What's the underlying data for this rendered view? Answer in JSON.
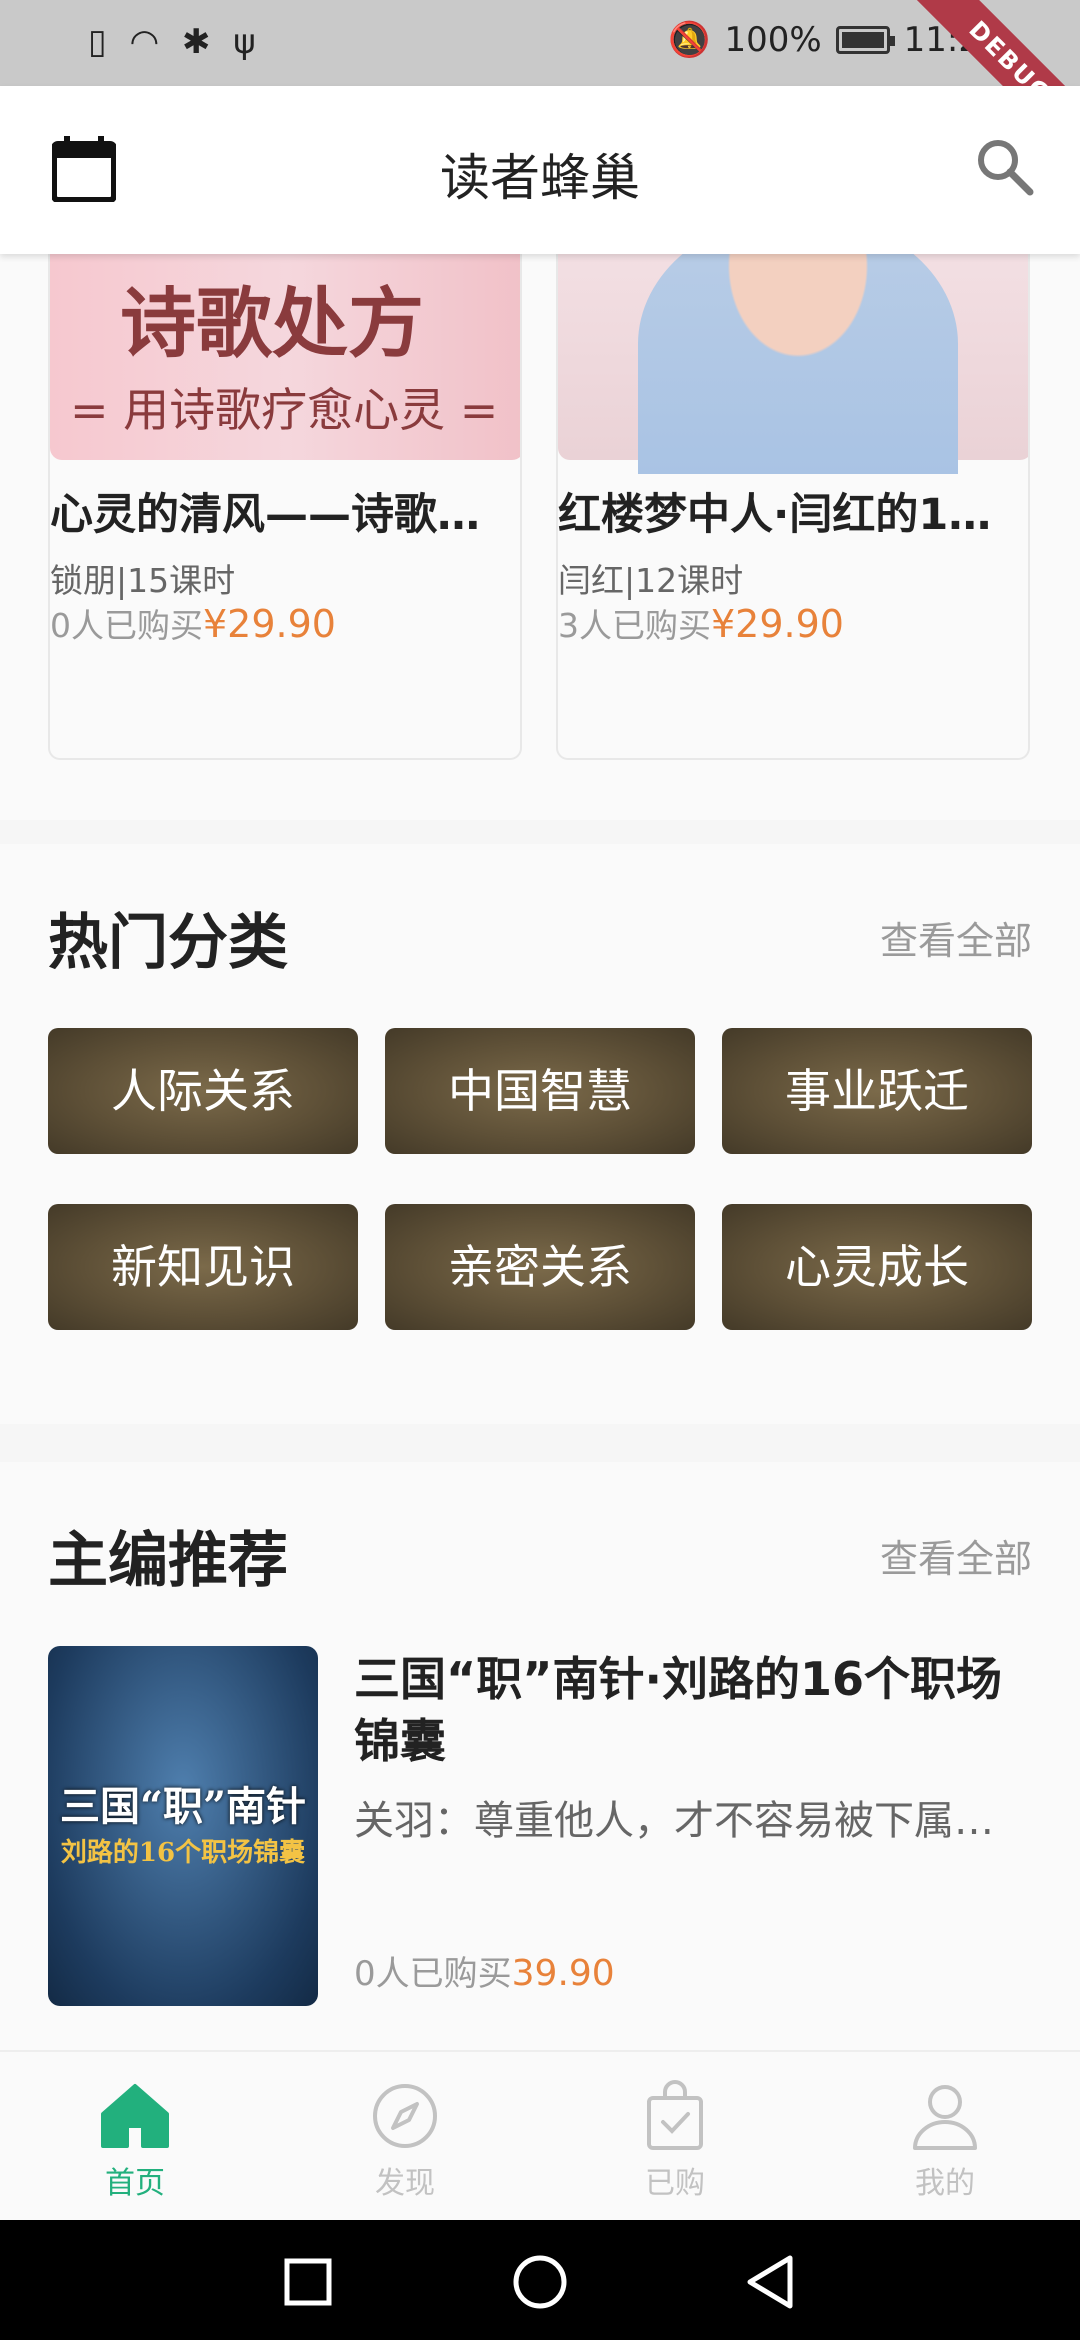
{
  "status_bar": {
    "battery": "100%",
    "time": "11:2"
  },
  "debug_banner": "DEBUG",
  "app_bar": {
    "title": "读者蜂巢",
    "left_icon": "calendar-icon",
    "right_icon": "search-icon"
  },
  "courses": [
    {
      "cover_line1": "诗歌处方",
      "cover_line2": "= 用诗歌疗愈心灵 =",
      "name": "心灵的清风——诗歌…",
      "meta": "锁朋|15课时",
      "buyers": "0人已购买",
      "price": "¥29.90"
    },
    {
      "name": "红楼梦中人·闫红的1…",
      "meta": "闫红|12课时",
      "buyers": "3人已购买",
      "price": "¥29.90"
    }
  ],
  "hot_categories": {
    "title": "热门分类",
    "more": "查看全部",
    "items": [
      "人际关系",
      "中国智慧",
      "事业跃迁",
      "新知见识",
      "亲密关系",
      "心灵成长"
    ]
  },
  "editor_picks": {
    "title": "主编推荐",
    "more": "查看全部",
    "item": {
      "cover_line1": "三国“职”南针",
      "cover_line2": "刘路的16个职场锦囊",
      "title": "三国“职”南针·刘路的16个职场锦囊",
      "desc": "关羽：尊重他人，才不容易被下属…",
      "buyers": "0人已购买",
      "price": "39.90"
    }
  },
  "bottom_nav": [
    {
      "label": "首页",
      "icon": "home-icon",
      "active": true
    },
    {
      "label": "发现",
      "icon": "compass-icon",
      "active": false
    },
    {
      "label": "已购",
      "icon": "purchased-bag-icon",
      "active": false
    },
    {
      "label": "我的",
      "icon": "profile-icon",
      "active": false
    }
  ],
  "colors": {
    "accent": "#22b07d",
    "price": "#e8823a",
    "category_bg": "#5e5037"
  }
}
